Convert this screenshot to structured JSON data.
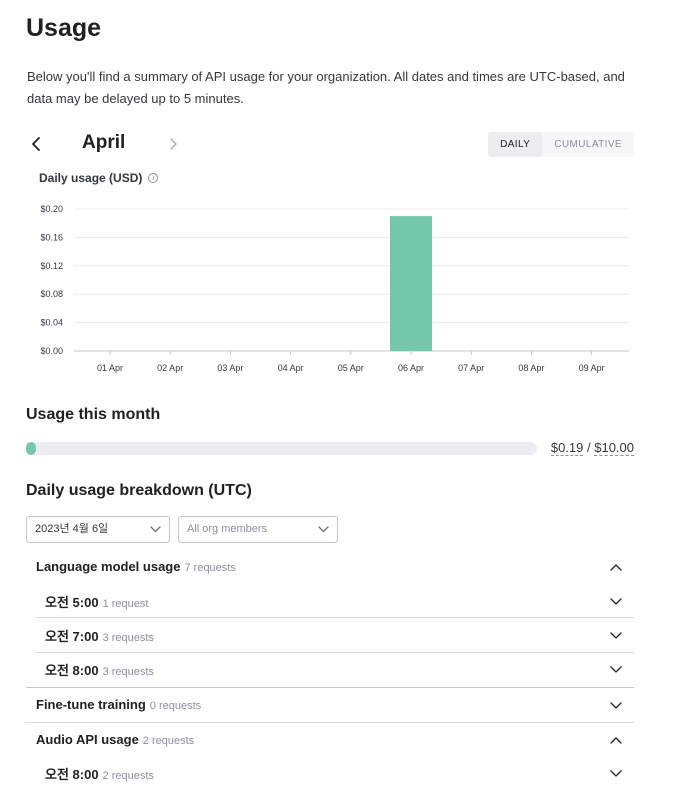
{
  "page": {
    "title": "Usage",
    "intro": "Below you'll find a summary of API usage for your organization. All dates and times are UTC-based, and data may be delayed up to 5 minutes."
  },
  "month_nav": {
    "month": "April",
    "prev_icon": "chevron-left-icon",
    "next_icon": "chevron-right-icon",
    "toggle": {
      "daily": "DAILY",
      "cumulative": "CUMULATIVE",
      "selected": "daily"
    }
  },
  "chart_data": {
    "type": "bar",
    "title": "Daily usage (USD)",
    "xlabel": "",
    "ylabel": "",
    "categories": [
      "01 Apr",
      "02 Apr",
      "03 Apr",
      "04 Apr",
      "05 Apr",
      "06 Apr",
      "07 Apr",
      "08 Apr",
      "09 Apr"
    ],
    "values": [
      0,
      0,
      0,
      0,
      0,
      0.19,
      0,
      0,
      0
    ],
    "ylim": [
      0,
      0.2
    ],
    "yticks": [
      "$0.00",
      "$0.04",
      "$0.08",
      "$0.12",
      "$0.16",
      "$0.20"
    ],
    "ytick_values": [
      0,
      0.04,
      0.08,
      0.12,
      0.16,
      0.2
    ],
    "grid": true,
    "bar_color": "#74c9ad"
  },
  "usage_month": {
    "title": "Usage this month",
    "used": "$0.19",
    "separator": " / ",
    "limit": "$10.00",
    "fraction": 0.019,
    "color": "#74c9ad"
  },
  "breakdown": {
    "title": "Daily usage breakdown (UTC)",
    "date_select": "2023년 4월 6일",
    "member_select": "All org members",
    "groups": [
      {
        "label": "Language model usage",
        "count": "7 requests",
        "expanded": true,
        "items": [
          {
            "time": "오전 5:00",
            "count": "1 request"
          },
          {
            "time": "오전 7:00",
            "count": "3 requests"
          },
          {
            "time": "오전 8:00",
            "count": "3 requests"
          }
        ]
      },
      {
        "label": "Fine-tune training",
        "count": "0 requests",
        "expanded": false,
        "items": []
      },
      {
        "label": "Audio API usage",
        "count": "2 requests",
        "expanded": true,
        "items": [
          {
            "time": "오전 8:00",
            "count": "2 requests"
          }
        ]
      }
    ]
  }
}
